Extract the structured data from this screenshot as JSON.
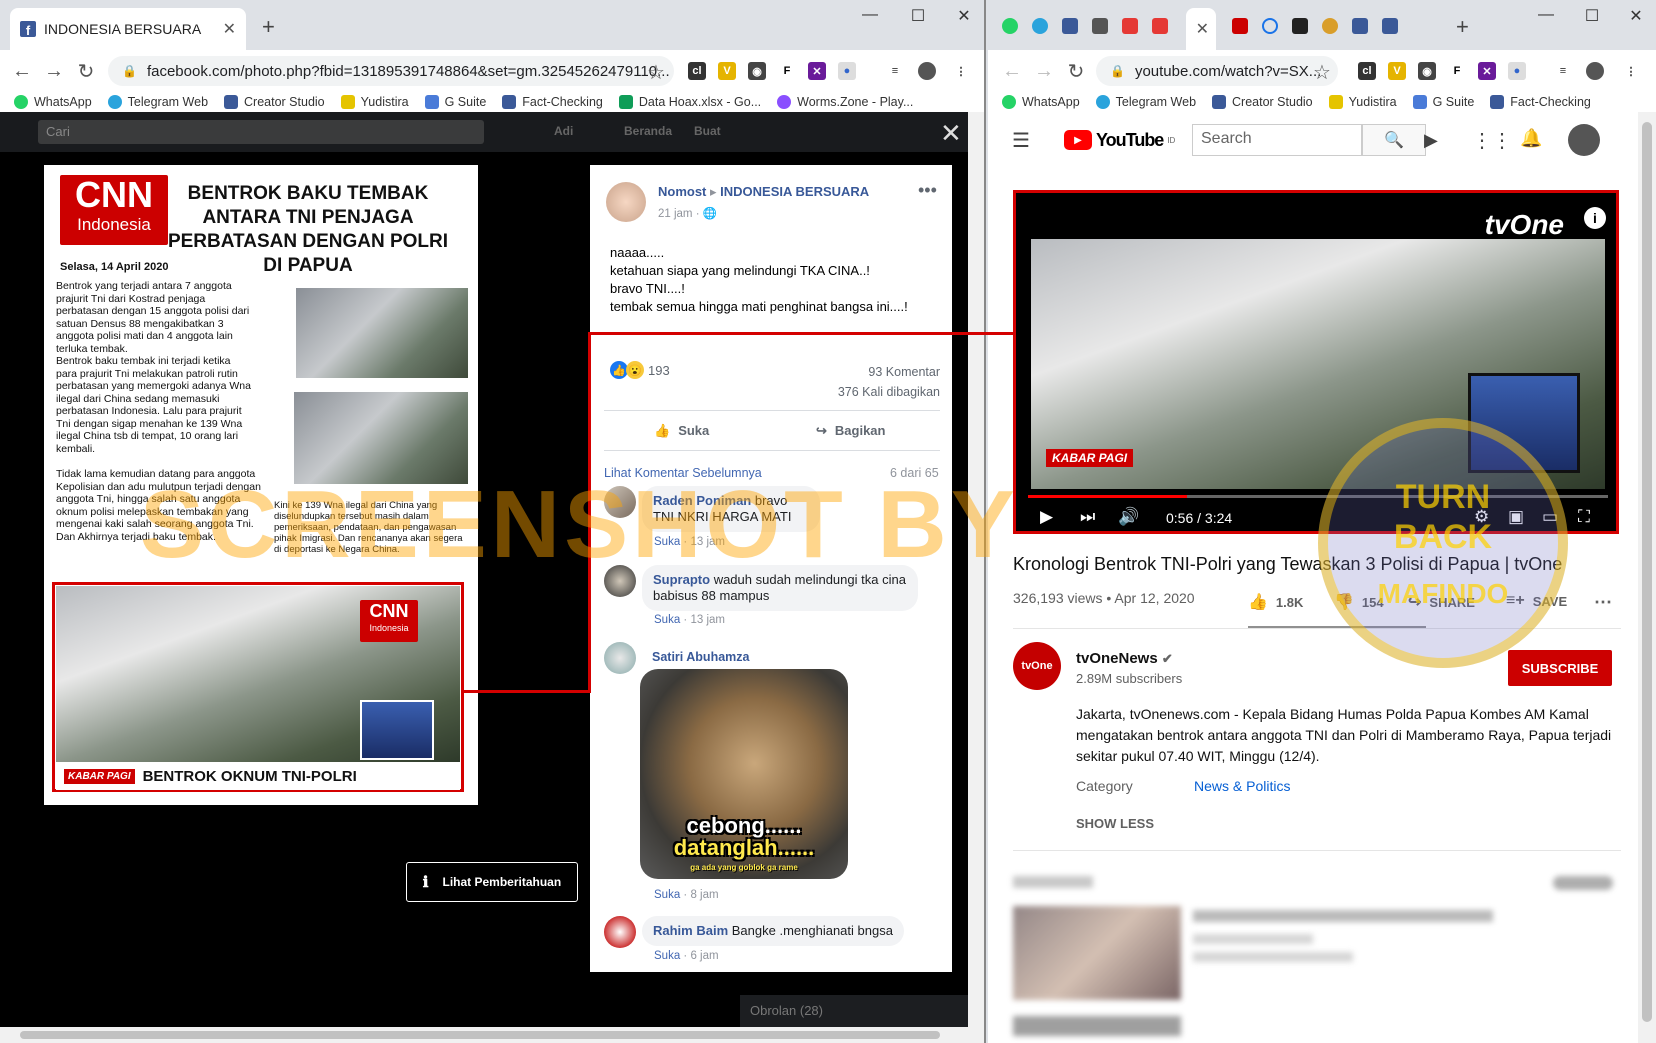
{
  "left": {
    "tab_title": "INDONESIA BERSUARA",
    "url": "facebook.com/photo.php?fbid=131895391748864&set=gm.32545262479110...",
    "bookmarks": [
      "WhatsApp",
      "Telegram Web",
      "Creator Studio",
      "Yudistira",
      "G Suite",
      "Fact-Checking",
      "Data Hoax.xlsx - Go...",
      "Worms.Zone - Play..."
    ],
    "fb_search_placeholder": "Cari",
    "fb_nav": [
      "Adi",
      "Beranda",
      "Buat"
    ],
    "photo": {
      "cnn_logo": "CNN",
      "cnn_sub": "Indonesia",
      "headline": "BENTROK  BAKU TEMBAK ANTARA TNI PENJAGA PERBATASAN DENGAN POLRI DI PAPUA",
      "date": "Selasa, 14 April 2020",
      "body1": "Bentrok yang terjadi antara 7 anggota prajurit Tni dari Kostrad penjaga perbatasan dengan 15 anggota polisi dari satuan Densus 88 mengakibatkan 3 anggota polisi mati dan 4 anggota lain terluka tembak.",
      "body2": "Bentrok baku tembak ini terjadi ketika para prajurit Tni melakukan patroli rutin perbatasan yang memergoki adanya Wna ilegal dari China sedang memasuki perbatasan Indonesia. Lalu para prajurit Tni dengan sigap menahan ke 139 Wna ilegal China tsb di tempat, 10 orang lari kembali.",
      "body3": "Tidak lama kemudian datang para anggota Kepolisian dan adu mulutpun terjadi dengan anggota Tni, hingga salah satu anggota oknum polisi melepaskan tembakan yang mengenai kaki salah seorang anggota Tni. Dan Akhirnya terjadi baku tembak.",
      "caption": "Kini ke 139 Wna ilegal dari China yang diselundupkan tersebut masih dalam pemeriksaan, pendataan, dan pengawasan pihak Imigrasi. Dan rencananya akan segera di deportasi ke Negara China.",
      "banner_tag": "KABAR PAGI",
      "banner_text": "BENTROK OKNUM TNI-POLRI"
    },
    "watermark": "SCREENSHOT BY",
    "notice_button": "Lihat Pemberitahuan",
    "post": {
      "author": "Nomost",
      "group": "INDONESIA BERSUARA",
      "time": "21 jam",
      "text": [
        "naaaa.....",
        "ketahuan siapa yang melindungi TKA CINA..!",
        "bravo TNI....!",
        "tembak semua hingga mati penghinat bangsa ini....!"
      ],
      "reactions": "193",
      "comments_count": "93 Komentar",
      "shares_count": "376 Kali dibagikan",
      "like_label": "Suka",
      "share_label": "Bagikan",
      "prev_comments": "Lihat Komentar Sebelumnya",
      "comments_of": "6 dari 65"
    },
    "comments": [
      {
        "name": "Raden Poniman",
        "text": "bravo TNI NKRI HARGA MATI",
        "like": "Suka",
        "time": "13 jam"
      },
      {
        "name": "Suprapto",
        "text": "waduh sudah melindungi tka cina babisus 88 mampus",
        "like": "Suka",
        "time": "13 jam"
      },
      {
        "name": "Satiri Abuhamza",
        "text": "",
        "like": "Suka",
        "time": "8 jam"
      },
      {
        "name": "Rahim Baim",
        "text": "Bangke .menghianati bngsa",
        "like": "Suka",
        "time": "6 jam"
      }
    ],
    "meme_line1": "cebong......",
    "meme_line2": "datanglah......",
    "meme_small": "ga ada yang goblok ga rame",
    "chat": "Obrolan (28)"
  },
  "right": {
    "url": "youtube.com/watch?v=SX...",
    "bookmarks": [
      "WhatsApp",
      "Telegram Web",
      "Creator Studio",
      "Yudistira",
      "G Suite",
      "Fact-Checking"
    ],
    "logo": "YouTube",
    "logo_region": "ID",
    "search_placeholder": "Search",
    "channel_bug": "tvOne",
    "time": "0:56 / 3:24",
    "progress": 0.2745,
    "title": "Kronologi Bentrok TNI-Polri yang Tewaskan 3 Polisi di Papua | tvOne",
    "views": "326,193 views • Apr 12, 2020",
    "likes": "1.8K",
    "dislikes": "154",
    "share": "SHARE",
    "save": "SAVE",
    "channel": "tvOneNews",
    "subscribers": "2.89M subscribers",
    "subscribe": "SUBSCRIBE",
    "description": "Jakarta, tvOnenews.com - Kepala Bidang Humas Polda Papua Kombes AM Kamal mengatakan bentrok antara anggota TNI dan Polri di Mamberamo Raya, Papua terjadi sekitar pukul 07.40 WIT, Minggu (12/4).",
    "category_label": "Category",
    "category_value": "News & Politics",
    "show_less": "SHOW LESS",
    "seal_top": "TURN",
    "seal_mid": "BACK",
    "seal_bottom": "MAFINDO"
  }
}
